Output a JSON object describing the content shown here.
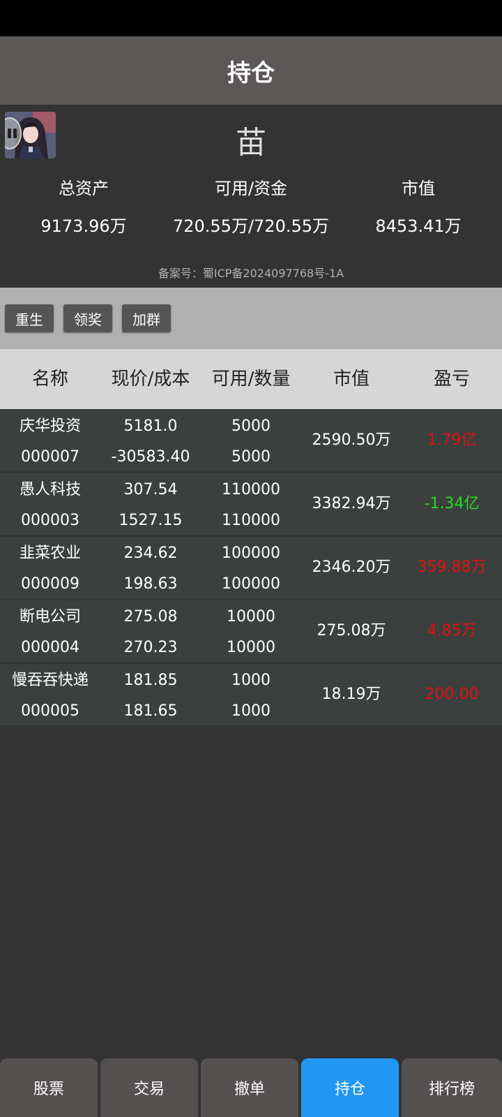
{
  "header": {
    "title": "持仓"
  },
  "profile": {
    "nickname": "苗",
    "stats": [
      {
        "label": "总资产",
        "value": "9173.96万"
      },
      {
        "label": "可用/资金",
        "value": "720.55万/720.55万"
      },
      {
        "label": "市值",
        "value": "8453.41万"
      }
    ],
    "icp": "备案号：蜀ICP备2024097768号-1A"
  },
  "actions": [
    {
      "label": "重生"
    },
    {
      "label": "领奖"
    },
    {
      "label": "加群"
    }
  ],
  "table": {
    "headers": [
      "名称",
      "现价/成本",
      "可用/数量",
      "市值",
      "盈亏"
    ],
    "rows": [
      {
        "name": "庆华投资",
        "code": "000007",
        "price": "5181.0",
        "cost": "-30583.40",
        "available": "5000",
        "quantity": "5000",
        "market_value": "2590.50万",
        "pl": "1.79亿",
        "pl_color": "#e01010"
      },
      {
        "name": "愚人科技",
        "code": "000003",
        "price": "307.54",
        "cost": "1527.15",
        "available": "110000",
        "quantity": "110000",
        "market_value": "3382.94万",
        "pl": "-1.34亿",
        "pl_color": "#22dd22"
      },
      {
        "name": "韭菜农业",
        "code": "000009",
        "price": "234.62",
        "cost": "198.63",
        "available": "100000",
        "quantity": "100000",
        "market_value": "2346.20万",
        "pl": "359.88万",
        "pl_color": "#e01010"
      },
      {
        "name": "断电公司",
        "code": "000004",
        "price": "275.08",
        "cost": "270.23",
        "available": "10000",
        "quantity": "10000",
        "market_value": "275.08万",
        "pl": "4.85万",
        "pl_color": "#e01010"
      },
      {
        "name": "慢吞吞快递",
        "code": "000005",
        "price": "181.85",
        "cost": "181.65",
        "available": "1000",
        "quantity": "1000",
        "market_value": "18.19万",
        "pl": "200.00",
        "pl_color": "#e01010"
      }
    ]
  },
  "nav": {
    "tabs": [
      {
        "label": "股票"
      },
      {
        "label": "交易"
      },
      {
        "label": "撤单"
      },
      {
        "label": "持仓"
      },
      {
        "label": "排行榜"
      }
    ],
    "active_color": "#2196f3"
  }
}
